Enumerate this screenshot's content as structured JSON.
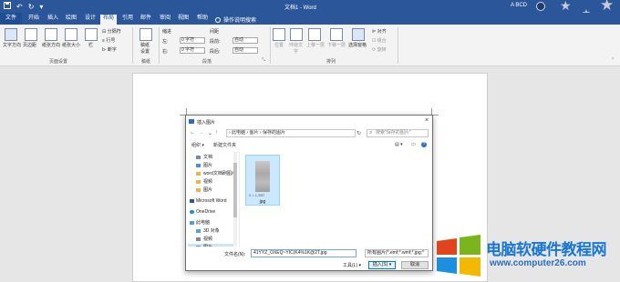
{
  "titlebar": {
    "title": "文档1 - Word",
    "user": "A BCD",
    "qat_icons": [
      "save-icon",
      "undo-icon",
      "redo-icon",
      "customize-icon"
    ]
  },
  "tabs": {
    "file": "文件",
    "items": [
      "开始",
      "插入",
      "绘图",
      "设计",
      "布局",
      "引用",
      "邮件",
      "审阅",
      "视图",
      "帮助"
    ],
    "active_index": 4,
    "tell_me": "操作说明搜索"
  },
  "ribbon": {
    "page_setup": {
      "text_direction": "文字方向",
      "margins": "页边距",
      "orientation": "纸张方向",
      "size": "纸张大小",
      "columns": "栏",
      "breaks": "分隔符",
      "line_numbers": "行号",
      "hyphenation": "断字",
      "group_label": "页面设置"
    },
    "draft": {
      "label_line1": "稿纸",
      "label_line2": "设置",
      "group_label": "稿纸"
    },
    "paragraph": {
      "indent_header": "缩进",
      "spacing_header": "间距",
      "left_label": "左:",
      "left_value": "0 字符",
      "right_label": "右:",
      "right_value": "0 字符",
      "before_label": "段前:",
      "before_value": "自动",
      "after_label": "段后:",
      "after_value": "自动",
      "group_label": "段落"
    },
    "arrange": {
      "position": "位置",
      "wrap_line1": "环绕文",
      "wrap_line2": "字",
      "bring_forward": "上移一层",
      "send_backward": "下移一层",
      "selection_pane": "选择窗格",
      "align": "对齐",
      "group": "组合",
      "rotate": "旋转",
      "group_label": "排列"
    }
  },
  "dialog": {
    "title": "插入图片",
    "breadcrumb": "›  此电脑  ›  图片  ›  保存的图片",
    "search_placeholder": "搜索\"保存的图片\"",
    "organize": "组织 ▾",
    "new_folder": "新建文件夹",
    "nav_items": [
      {
        "label": "文档",
        "icon": "document-icon"
      },
      {
        "label": "图片",
        "icon": "picture-icon"
      },
      {
        "label": "word文档刷图片总",
        "icon": "folder-icon"
      },
      {
        "label": "视频",
        "icon": "folder-icon"
      },
      {
        "label": "图片",
        "icon": "folder-icon"
      },
      {
        "label": "Microsoft Word",
        "icon": "word-icon"
      },
      {
        "label": "OneDrive",
        "icon": "onedrive-icon"
      },
      {
        "label": "此电脑",
        "icon": "computer-icon"
      },
      {
        "label": "3D 对象",
        "icon": "3d-objects-icon"
      },
      {
        "label": "视频",
        "icon": "video-icon"
      },
      {
        "label": "图片",
        "icon": "picture-icon"
      }
    ],
    "selected_nav_index": 10,
    "file": {
      "name": "jpg",
      "dims": "0 × 1,2B7"
    },
    "filename_label": "文件名(N):",
    "filename_value": "41YYZ_OXEQ~YIC(K4%1K@2T.jpg",
    "filetype": "所有图片(*.emf;*.wmf;*.jpg;*",
    "tools": "工具(L) ▾",
    "insert": "插入(S) ▾",
    "cancel": "取消"
  },
  "watermark": {
    "site_name": "电脑软硬件教程网",
    "url": "www.computer26.com"
  },
  "colors": {
    "word_blue": "#2b579a",
    "ribbon_bg": "#f3f3f3",
    "selection": "#cce4f7",
    "watermark_blue": "#1976d2"
  }
}
